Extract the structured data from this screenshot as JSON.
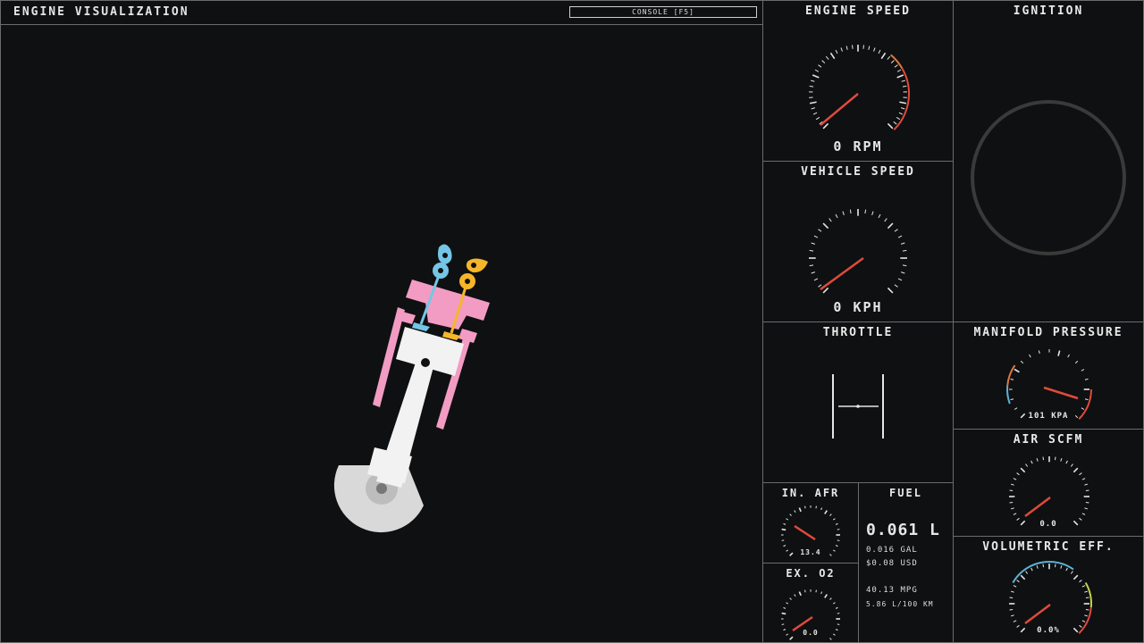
{
  "visualization": {
    "title": "ENGINE VISUALIZATION",
    "console_label": "CONSOLE [F5]"
  },
  "engine_speed": {
    "title": "ENGINE SPEED",
    "readout": "0 RPM",
    "value": 0
  },
  "vehicle_speed": {
    "title": "VEHICLE SPEED",
    "readout": "0 KPH",
    "value": 0
  },
  "ignition": {
    "title": "IGNITION"
  },
  "throttle": {
    "title": "THROTTLE",
    "position": 0
  },
  "manifold_pressure": {
    "title": "MANIFOLD PRESSURE",
    "readout": "101 KPA"
  },
  "air_scfm": {
    "title": "AIR SCFM",
    "readout": "0.0"
  },
  "intake_afr": {
    "title": "IN. AFR",
    "readout": "13.4"
  },
  "exhaust_o2": {
    "title": "EX. O2",
    "readout": "0.0"
  },
  "volumetric_eff": {
    "title": "VOLUMETRIC EFF.",
    "readout": "0.0%"
  },
  "fuel": {
    "title": "FUEL",
    "liters": "0.061 L",
    "gallons": "0.016 GAL",
    "cost": "$0.08 USD",
    "mpg": "40.13 MPG",
    "l_per_100km": "5.86 L/100 KM"
  },
  "colors": {
    "background": "#0f1012",
    "border": "#6b6b6b",
    "needle": "#e04a3c",
    "redline": "#e04a3c",
    "warn": "#e07a3c",
    "cold": "#5ab4d6",
    "piston_pink": "#f29cc3",
    "intake_cam": "#74c6e6",
    "exhaust_cam": "#f5b62a",
    "metal": "#f2f2f2",
    "crank": "#d9d9d9"
  }
}
